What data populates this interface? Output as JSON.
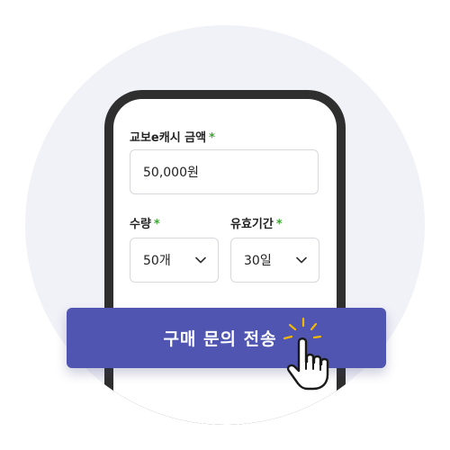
{
  "form": {
    "amount": {
      "label": "교보e캐시 금액",
      "required_mark": "*",
      "value": "50,000원"
    },
    "quantity": {
      "label": "수량",
      "required_mark": "*",
      "value": "50개"
    },
    "validity": {
      "label": "유효기간",
      "required_mark": "*",
      "value": "30일"
    },
    "submit_label": "구매 문의 전송"
  },
  "icons": {
    "dropdown": "chevron-down-icon",
    "pointer": "hand-pointer-icon"
  },
  "colors": {
    "primary": "#4f55b1",
    "required": "#3fa535",
    "background_circle": "#f1f1f8",
    "phone_frame": "#2f2f2f",
    "sparkle": "#f2b705"
  }
}
